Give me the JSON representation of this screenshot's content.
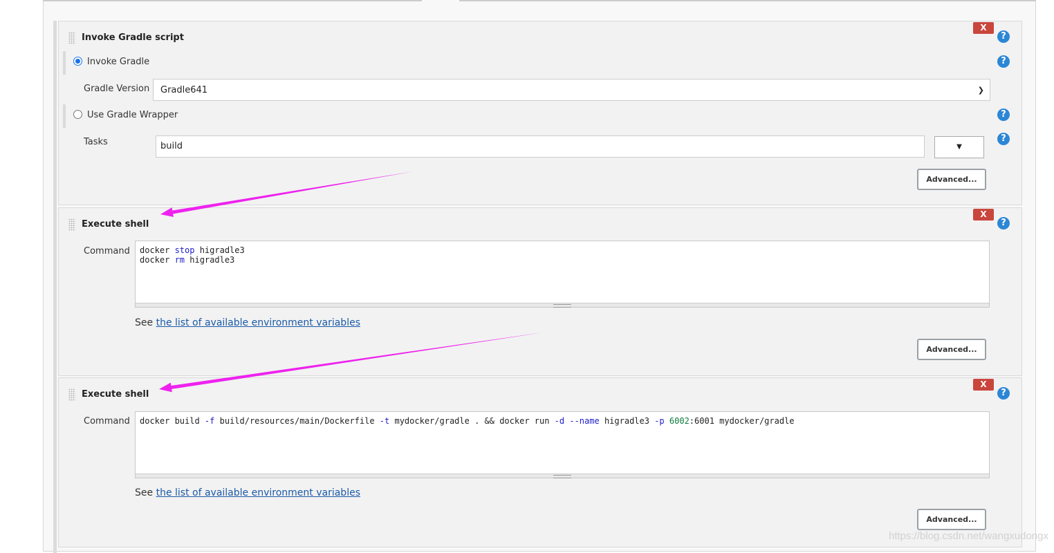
{
  "gradle_step": {
    "title": "Invoke Gradle script",
    "remove": "X",
    "help": "?",
    "invoke_gradle_label": "Invoke Gradle",
    "invoke_gradle_selected": true,
    "gradle_version_label": "Gradle Version",
    "gradle_version_value": "Gradle641",
    "use_wrapper_label": "Use Gradle Wrapper",
    "tasks_label": "Tasks",
    "tasks_value": "build",
    "tasks_dropdown": "▼",
    "advanced": "Advanced..."
  },
  "shell1": {
    "title": "Execute shell",
    "remove": "X",
    "help": "?",
    "command_label": "Command",
    "lines": [
      [
        "docker ",
        "stop",
        " higradle3"
      ],
      [
        "docker ",
        "rm",
        " higradle3"
      ]
    ],
    "see_prefix": "See ",
    "see_link": "the list of available environment variables",
    "advanced": "Advanced..."
  },
  "shell2": {
    "title": "Execute shell",
    "remove": "X",
    "help": "?",
    "command_label": "Command",
    "cmd": {
      "a": "docker build ",
      "b": "-f",
      "c": " build/resources/main/Dockerfile ",
      "d": "-t",
      "e": " mydocker/gradle . && docker run ",
      "f": "-d",
      " g": "",
      "h": " ",
      "i": "--name",
      "j": " higradle3 ",
      "k": "-p",
      "l": " ",
      "m": "6002",
      "n": ":6001 mydocker/gradle"
    },
    "see_prefix": "See ",
    "see_link": "the list of available environment variables",
    "advanced": "Advanced..."
  },
  "annotation_color": "#ee22ee",
  "watermark": "https://blog.csdn.net/wangxudongx"
}
